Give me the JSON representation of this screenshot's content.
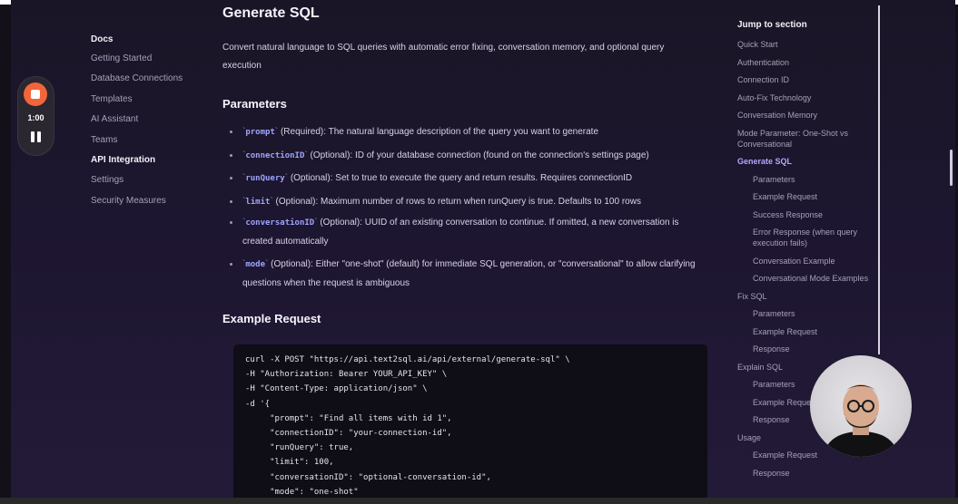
{
  "docs_nav": {
    "title": "Docs",
    "items": [
      {
        "label": "Getting Started",
        "active": false
      },
      {
        "label": "Database Connections",
        "active": false
      },
      {
        "label": "Templates",
        "active": false
      },
      {
        "label": "AI Assistant",
        "active": false
      },
      {
        "label": "Teams",
        "active": false
      },
      {
        "label": "API Integration",
        "active": true
      },
      {
        "label": "Settings",
        "active": false
      },
      {
        "label": "Security Measures",
        "active": false
      }
    ]
  },
  "recorder": {
    "time": "1:00",
    "record_icon": "stop-record-icon",
    "pause_icon": "pause-icon"
  },
  "main": {
    "title": "Generate SQL",
    "intro": "Convert natural language to SQL queries with automatic error fixing, conversation memory, and optional query execution",
    "parameters_heading": "Parameters",
    "parameters": [
      {
        "name": "prompt",
        "text": " (Required): The natural language description of the query you want to generate"
      },
      {
        "name": "connectionID",
        "text": " (Optional): ID of your database connection (found on the connection's settings page)"
      },
      {
        "name": "runQuery",
        "text": " (Optional): Set to true to execute the query and return results. Requires connectionID"
      },
      {
        "name": "limit",
        "text": " (Optional): Maximum number of rows to return when runQuery is true. Defaults to 100 rows"
      },
      {
        "name": "conversationID",
        "text": " (Optional): UUID of an existing conversation to continue. If omitted, a new conversation is created automatically"
      },
      {
        "name": "mode",
        "text": " (Optional): Either \"one-shot\" (default) for immediate SQL generation, or \"conversational\" to allow clarifying questions when the request is ambiguous"
      }
    ],
    "example_heading": "Example Request",
    "code_lines": [
      "curl -X POST \"https://api.text2sql.ai/api/external/generate-sql\" \\",
      "-H \"Authorization: Bearer YOUR_API_KEY\" \\",
      "-H \"Content-Type: application/json\" \\",
      "-d '{",
      "     \"prompt\": \"Find all items with id 1\",",
      "     \"connectionID\": \"your-connection-id\",",
      "     \"runQuery\": true,",
      "     \"limit\": 100,",
      "     \"conversationID\": \"optional-conversation-id\",",
      "     \"mode\": \"one-shot\""
    ]
  },
  "toc": {
    "title": "Jump to section",
    "items": [
      {
        "label": "Quick Start",
        "level": 0,
        "active": false
      },
      {
        "label": "Authentication",
        "level": 0,
        "active": false
      },
      {
        "label": "Connection ID",
        "level": 0,
        "active": false
      },
      {
        "label": "Auto-Fix Technology",
        "level": 0,
        "active": false
      },
      {
        "label": "Conversation Memory",
        "level": 0,
        "active": false
      },
      {
        "label": "Mode Parameter: One-Shot vs Conversational",
        "level": 0,
        "active": false
      },
      {
        "label": "Generate SQL",
        "level": 0,
        "active": true
      },
      {
        "label": "Parameters",
        "level": 1,
        "active": false
      },
      {
        "label": "Example Request",
        "level": 1,
        "active": false
      },
      {
        "label": "Success Response",
        "level": 1,
        "active": false
      },
      {
        "label": "Error Response (when query execution fails)",
        "level": 1,
        "active": false
      },
      {
        "label": "Conversation Example",
        "level": 1,
        "active": false
      },
      {
        "label": "Conversational Mode Examples",
        "level": 1,
        "active": false
      },
      {
        "label": "Fix SQL",
        "level": 0,
        "active": false
      },
      {
        "label": "Parameters",
        "level": 1,
        "active": false
      },
      {
        "label": "Example Request",
        "level": 1,
        "active": false
      },
      {
        "label": "Response",
        "level": 1,
        "active": false
      },
      {
        "label": "Explain SQL",
        "level": 0,
        "active": false
      },
      {
        "label": "Parameters",
        "level": 1,
        "active": false
      },
      {
        "label": "Example Request",
        "level": 1,
        "active": false
      },
      {
        "label": "Response",
        "level": 1,
        "active": false
      },
      {
        "label": "Usage",
        "level": 0,
        "active": false
      },
      {
        "label": "Example Request",
        "level": 1,
        "active": false
      },
      {
        "label": "Response",
        "level": 1,
        "active": false
      }
    ]
  },
  "colors": {
    "accent": "#b9a5ff",
    "code_accent": "#9ea4ff",
    "record": "#f2653a",
    "background": "#1d1630"
  }
}
